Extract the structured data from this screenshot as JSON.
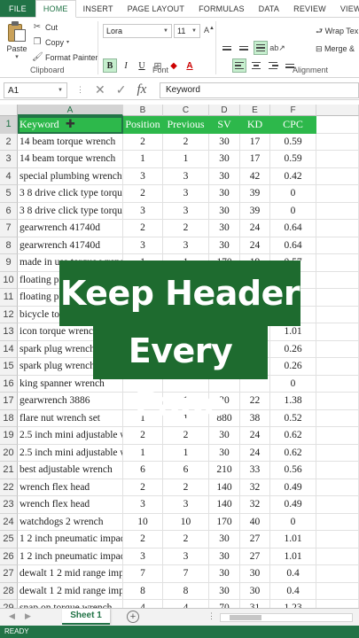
{
  "ribbon_tabs": [
    "FILE",
    "HOME",
    "INSERT",
    "PAGE LAYOUT",
    "FORMULAS",
    "DATA",
    "REVIEW",
    "VIEW"
  ],
  "clipboard": {
    "paste": "Paste",
    "cut": "Cut",
    "copy": "Copy",
    "format_painter": "Format Painter",
    "group_label": "Clipboard"
  },
  "font": {
    "name": "Lora",
    "size": "11",
    "bold": "B",
    "italic": "I",
    "underline": "U",
    "group_label": "Font"
  },
  "alignment": {
    "wrap_text": "Wrap Tex",
    "merge": "Merge &",
    "group_label": "Alignment"
  },
  "formula_bar": {
    "name_box": "A1",
    "fx": "fx",
    "content": "Keyword"
  },
  "columns": [
    "A",
    "B",
    "C",
    "D",
    "E",
    "F"
  ],
  "sheet": {
    "header": [
      "Keyword",
      "Position",
      "Previous",
      "SV",
      "KD",
      "CPC"
    ],
    "rows": [
      [
        "14 beam torque wrench",
        "2",
        "2",
        "30",
        "17",
        "0.59"
      ],
      [
        "14 beam torque wrench",
        "1",
        "1",
        "30",
        "17",
        "0.59"
      ],
      [
        "special plumbing wrench",
        "3",
        "3",
        "30",
        "42",
        "0.42"
      ],
      [
        "3 8 drive click type torque",
        "2",
        "3",
        "30",
        "39",
        "0"
      ],
      [
        "3 8 drive click type torque",
        "3",
        "3",
        "30",
        "39",
        "0"
      ],
      [
        "gearwrench 41740d",
        "2",
        "2",
        "30",
        "24",
        "0.64"
      ],
      [
        "gearwrench 41740d",
        "3",
        "3",
        "30",
        "24",
        "0.64"
      ],
      [
        "made in usa torque wrench",
        "1",
        "1",
        "170",
        "19",
        "0.57"
      ],
      [
        "floating pipe wrench",
        "",
        "",
        "",
        "",
        ""
      ],
      [
        "floating pipe wrench",
        "",
        "",
        "",
        "",
        ""
      ],
      [
        "bicycle torque wrench",
        "",
        "",
        "",
        "",
        ""
      ],
      [
        "icon torque wrench",
        "",
        "",
        "",
        "",
        "1.01"
      ],
      [
        "spark plug wrench",
        "",
        "",
        "",
        "",
        "0.26"
      ],
      [
        "spark plug wrench",
        "",
        "",
        "",
        "",
        "0.26"
      ],
      [
        "king spanner wrench",
        "",
        "",
        "",
        "",
        "0"
      ],
      [
        "gearwrench 3886",
        "1",
        "1",
        "30",
        "22",
        "1.38"
      ],
      [
        "flare nut wrench set",
        "1",
        "1",
        "880",
        "38",
        "0.52"
      ],
      [
        "2.5 inch mini adjustable wrench",
        "2",
        "2",
        "30",
        "24",
        "0.62"
      ],
      [
        "2.5 inch mini adjustable wrench",
        "1",
        "1",
        "30",
        "24",
        "0.62"
      ],
      [
        "best adjustable wrench",
        "6",
        "6",
        "210",
        "33",
        "0.56"
      ],
      [
        "wrench flex head",
        "2",
        "2",
        "140",
        "32",
        "0.49"
      ],
      [
        "wrench flex head",
        "3",
        "3",
        "140",
        "32",
        "0.49"
      ],
      [
        "watchdogs 2 wrench",
        "10",
        "10",
        "170",
        "40",
        "0"
      ],
      [
        "1 2 inch pneumatic impact",
        "2",
        "2",
        "30",
        "27",
        "1.01"
      ],
      [
        "1 2 inch pneumatic impact",
        "3",
        "3",
        "30",
        "27",
        "1.01"
      ],
      [
        "dewalt 1 2 mid range impact",
        "7",
        "7",
        "30",
        "30",
        "0.4"
      ],
      [
        "dewalt 1 2 mid range impact",
        "8",
        "8",
        "30",
        "30",
        "0.4"
      ],
      [
        "snap on torque wrench",
        "4",
        "4",
        "70",
        "31",
        "1.23"
      ],
      [
        "motorcycle oil filter wrench",
        "2",
        "2",
        "260",
        "25",
        "0.36"
      ]
    ]
  },
  "overlay": {
    "line1": "Keep Header on",
    "line2": "Every Page"
  },
  "sheet_tab": "Sheet 1",
  "status": "READY",
  "colors": {
    "excel_green": "#217346",
    "header_fill": "#2db84b",
    "overlay_bg": "#1e6b2f"
  },
  "icons": [
    "paste-icon",
    "cut-icon",
    "copy-icon",
    "format-painter-icon",
    "cancel-icon",
    "enter-icon",
    "add-sheet-icon"
  ]
}
